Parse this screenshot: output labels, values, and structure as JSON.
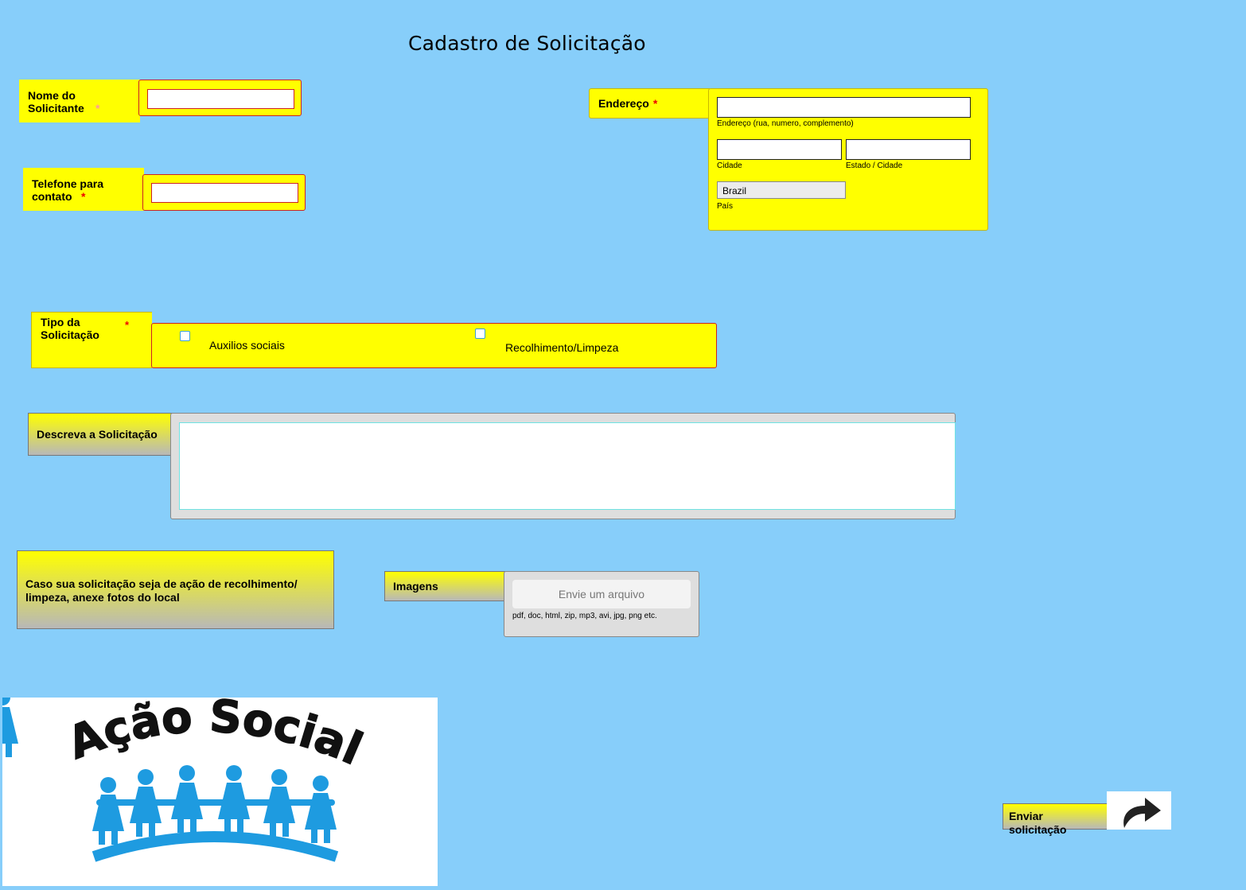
{
  "page": {
    "title": "Cadastro de Solicitação"
  },
  "fields": {
    "nome": {
      "label": "Nome do Solicitante",
      "required": "*",
      "value": ""
    },
    "telefone": {
      "label": "Telefone para contato",
      "required": "*",
      "value": ""
    },
    "endereco": {
      "label": "Endereço",
      "required": "*",
      "street_label": "Endereço (rua, numero, complemento)",
      "city_label": "Cidade",
      "state_label": "Estado / Cidade",
      "country_value": "Brazil",
      "country_label": "País"
    },
    "tipo": {
      "label": "Tipo da Solicitação",
      "required": "*",
      "options": [
        {
          "label": "Auxilios sociais",
          "checked": false
        },
        {
          "label": "Recolhimento/Limpeza",
          "checked": false
        }
      ]
    },
    "descricao": {
      "label": "Descreva a Solicitação",
      "value": ""
    },
    "anexo_info": {
      "text": "Caso sua solicitação seja de ação de recolhimento/ limpeza, anexe fotos do local"
    },
    "imagens": {
      "label": "Imagens",
      "button": "Envie um arquivo",
      "hint": "pdf, doc, html, zip, mp3, avi, jpg, png etc."
    }
  },
  "submit": {
    "label": "Enviar solicitação",
    "icon": "share-arrow-icon"
  },
  "logo": {
    "text": "Ação Social",
    "colors": {
      "figures": "#1e9be0",
      "text": "#111111"
    }
  },
  "colors": {
    "background": "#87cefa",
    "field": "#ffff00",
    "required": "#ee0000"
  }
}
